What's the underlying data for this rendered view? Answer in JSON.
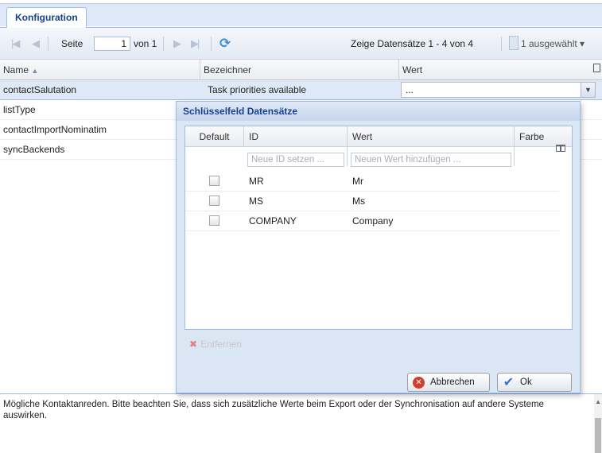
{
  "tabs": {
    "active": "Konfiguration"
  },
  "toolbar": {
    "page_label": "Seite",
    "page_value": "1",
    "page_of": "von 1",
    "display_info": "Zeige Datensätze 1 - 4 von 4",
    "selected_info": "1 ausgewählt"
  },
  "grid": {
    "columns": [
      "Name",
      "Bezeichner",
      "Wert"
    ],
    "sort_indicator": "▲",
    "rows": [
      {
        "name": "contactSalutation",
        "label": "Task priorities available",
        "value": "..."
      },
      {
        "name": "listType",
        "label": "",
        "value": ""
      },
      {
        "name": "contactImportNominatim",
        "label": "",
        "value": ""
      },
      {
        "name": "syncBackends",
        "label": "",
        "value": ""
      }
    ]
  },
  "dialog": {
    "title": "Schlüsselfeld Datensätze",
    "columns": {
      "default": "Default",
      "id": "ID",
      "wert": "Wert",
      "farbe": "Farbe"
    },
    "id_placeholder": "Neue ID setzen ...",
    "wert_placeholder": "Neuen Wert hinzufügen ...",
    "records": [
      {
        "id": "MR",
        "value": "Mr"
      },
      {
        "id": "MS",
        "value": "Ms"
      },
      {
        "id": "COMPANY",
        "value": "Company"
      }
    ],
    "remove_label": "Entfernen",
    "cancel_label": "Abbrechen",
    "ok_label": "Ok"
  },
  "description": "Mögliche Kontaktanreden. Bitte beachten Sie, dass sich zusätzliche Werte beim Export oder der Synchronisation auf andere Systeme auswirken."
}
